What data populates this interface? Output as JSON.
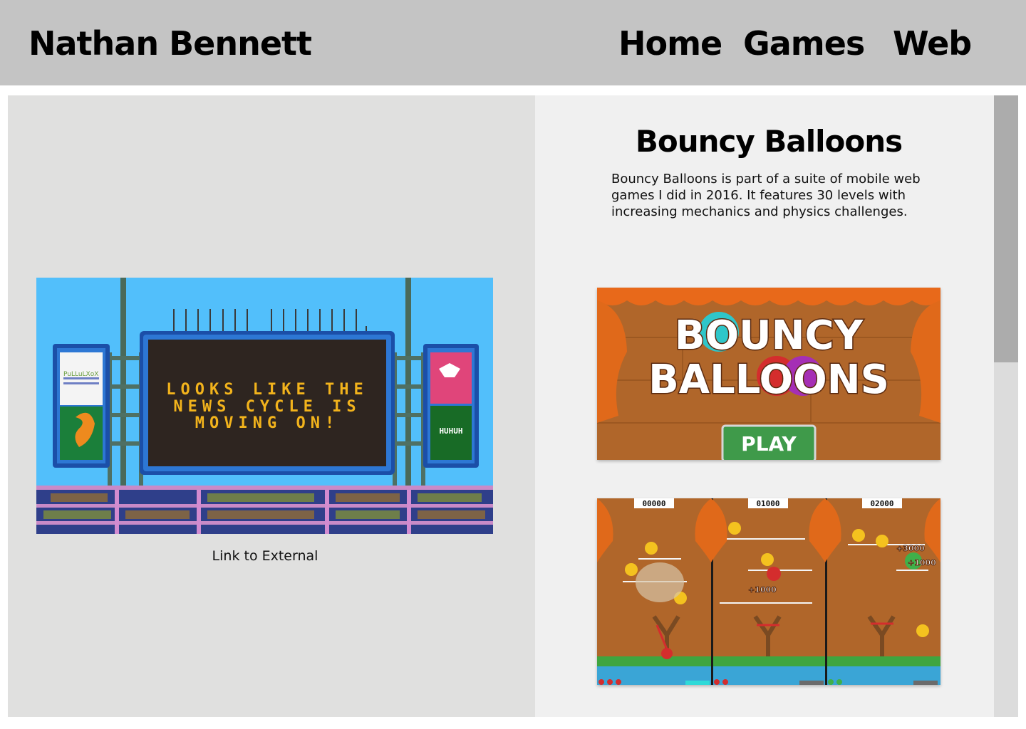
{
  "header": {
    "site_title": "Nathan Bennett",
    "nav": [
      {
        "label": "Home"
      },
      {
        "label": "Games"
      },
      {
        "label": "Web"
      }
    ]
  },
  "left_panel": {
    "preview": {
      "scoreboard_lines": [
        "LOOKS LIKE THE",
        "NEWS CYCLE IS",
        "MOVING ON!"
      ],
      "side_board_text": "HUHUH"
    },
    "link_label": "Link to External"
  },
  "right_panel": {
    "title": "Bouncy Balloons",
    "description": "Bouncy Balloons is part of a suite of mobile web games I did in 2016. It features 30 levels with increasing mechanics and physics challenges.",
    "title_screen": {
      "logo_line1": "BOUNCY",
      "logo_line2": "BALLOONS",
      "play_label": "PLAY"
    },
    "gameplay_scores": [
      "00000",
      "01000",
      "02000"
    ],
    "gameplay_popups": [
      "+1000",
      "+3000",
      "+1000"
    ]
  },
  "colors": {
    "header_bg": "#c4c4c4",
    "left_panel_bg": "#e0e0df",
    "right_panel_bg": "#f0f0f0",
    "scrollbar_thumb": "#acacac",
    "scoreboard_text": "#f2b31c",
    "sky": "#52bffb",
    "curtain": "#e8691a"
  }
}
